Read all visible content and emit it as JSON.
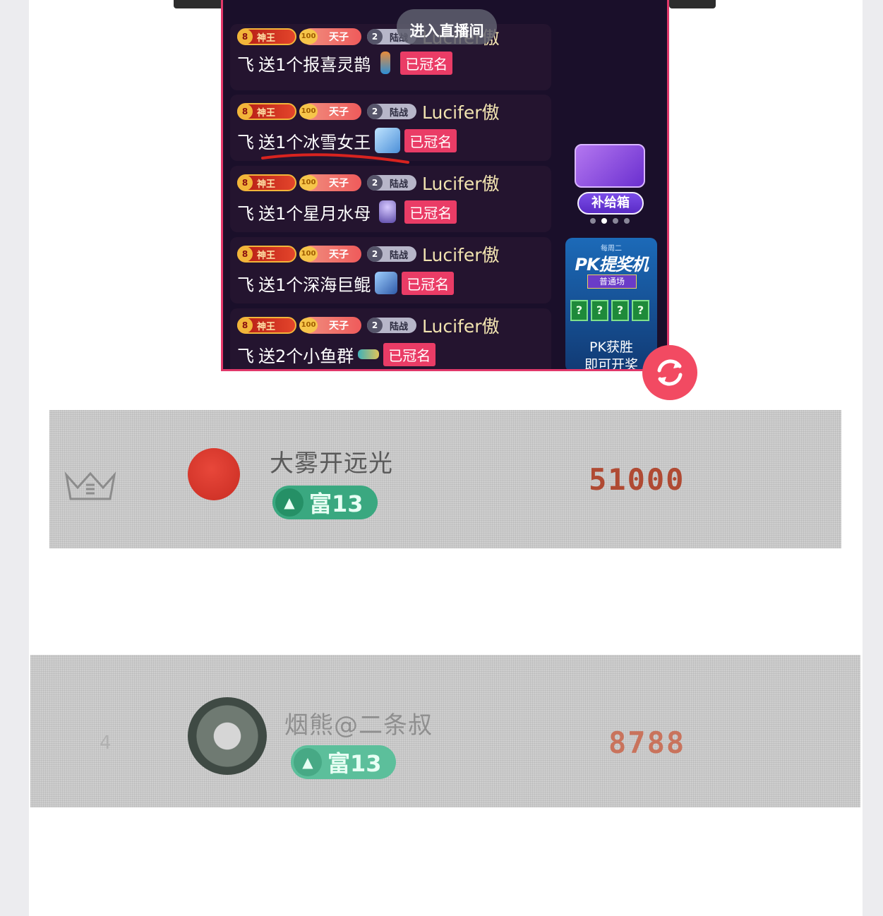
{
  "live": {
    "enter_button": "进入直播间",
    "messages": [
      {
        "badge_shen": "神王",
        "badge_tian": "天子",
        "badge_lu": "陆战",
        "user": "Lucifer傲",
        "prefix": "飞",
        "gift": "送1个报喜灵鹊",
        "tag": "已冠名"
      },
      {
        "badge_shen": "神王",
        "badge_tian": "天子",
        "badge_lu": "陆战",
        "user": "Lucifer傲",
        "prefix": "飞",
        "gift": "送1个冰雪女王",
        "tag": "已冠名"
      },
      {
        "badge_shen": "神王",
        "badge_tian": "天子",
        "badge_lu": "陆战",
        "user": "Lucifer傲",
        "prefix": "飞",
        "gift": "送1个星月水母",
        "tag": "已冠名"
      },
      {
        "badge_shen": "神王",
        "badge_tian": "天子",
        "badge_lu": "陆战",
        "user": "Lucifer傲",
        "prefix": "飞",
        "gift": "送1个深海巨鲲",
        "tag": "已冠名"
      },
      {
        "badge_shen": "神王",
        "badge_tian": "天子",
        "badge_lu": "陆战",
        "user": "Lucifer傲",
        "prefix": "飞",
        "gift": "送2个小鱼群",
        "tag": "已冠名"
      }
    ],
    "badge_icons": {
      "shen": "8",
      "tian": "100",
      "lu": "2"
    },
    "side": {
      "chest_label": "补给箱",
      "pk": {
        "top": "每周二",
        "title": "PK提奖机",
        "sub": "普通场",
        "boxes": [
          "?",
          "?",
          "?",
          "?"
        ],
        "win": "PK获胜",
        "open": "即可开奖"
      }
    }
  },
  "ranking": [
    {
      "name": "大雾开远光",
      "level": "富13",
      "score": "51000",
      "rank_icon": "crown-icon",
      "level_icon": "▲"
    },
    {
      "name": "烟熊@二条叔",
      "level": "富13",
      "score": "8788",
      "rank_icon": "rank-4",
      "rank_text": "4",
      "level_icon": "▲"
    }
  ],
  "colors": {
    "accent": "#ea3c66",
    "panel_bg": "#1a0f2a",
    "level_green": "#3aa880",
    "score": "#b04a33"
  }
}
